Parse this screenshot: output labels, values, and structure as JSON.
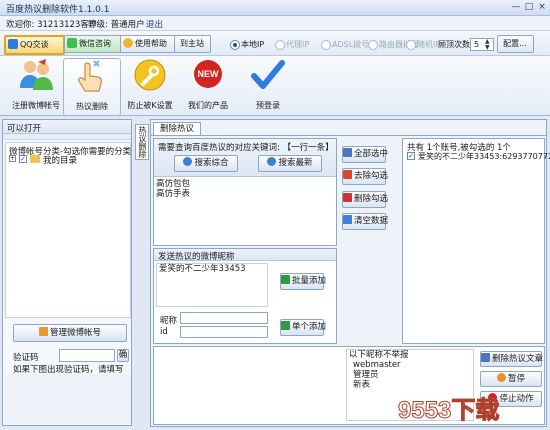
{
  "window": {
    "title": "百度热议删除软件1.1.0.1",
    "controls": [
      "—",
      "□",
      "×"
    ]
  },
  "info": {
    "welcome": "欢迎你: 31213123客户",
    "level": "等级: 普通用户",
    "logout": "退出"
  },
  "toolbar": {
    "qq": "QQ交谈",
    "wechat": "微信咨询",
    "help": "使用帮助",
    "site": "到主站",
    "ip_options": [
      "本地IP",
      "代理IP",
      "ADSL拨号",
      "路由器拨号",
      "随机IP"
    ],
    "ip_selected": "本地IP",
    "top_count_label": "顾顶次数",
    "top_count_value": "5",
    "config": "配置..."
  },
  "nav": [
    {
      "label": "注册微博帐号",
      "icon": "people-icon"
    },
    {
      "label": "热议删除",
      "icon": "hand-pointer-icon"
    },
    {
      "label": "防止被K设置",
      "icon": "wrench-icon"
    },
    {
      "label": "我们的产品",
      "icon": "new-badge-icon"
    },
    {
      "label": "预登录",
      "icon": "checkmark-icon"
    }
  ],
  "left": {
    "header": "可以打开",
    "tree_header": "微博帐号分类-勾选你需要的分类",
    "tree_item": "我的目录",
    "manage_btn": "管理微博帐号",
    "captcha_label": "验证码",
    "captcha_btn": "确",
    "captcha_hint": "如果下图出现验证码，请填写"
  },
  "vtab": "热议删除",
  "tab": "删除热议",
  "center": {
    "keyword_title": "需要查询百度热议的对应关键词: 【一行一条】",
    "search_all": "搜索综合",
    "search_latest": "搜索最新",
    "keywords": [
      "高仿包包",
      "高仿手表"
    ],
    "nick_title": "发送热议的微博昵称",
    "nicks": [
      "爱笑的不二少年33453"
    ],
    "batch_add": "批量添加",
    "nick_label": "昵称",
    "id_label": "id",
    "single_add": "单个添加"
  },
  "actions": {
    "select_all": "全部选中",
    "remove_checked": "去除勾选",
    "delete_checked": "删除勾选",
    "clear": "清空数据"
  },
  "right": {
    "summary": "共有 1个账号,被勾选的 1个",
    "accounts": [
      "爱笑的不二少年33453:6293770772"
    ]
  },
  "bottom": {
    "no_report_title": "以下昵称不举报",
    "no_report_list": [
      "webmaster",
      "管理员",
      "新表"
    ],
    "delete_btn": "删除热议文章",
    "pause_btn": "暂停",
    "stop_btn": "停止动作"
  },
  "watermark": "9553下载",
  "colors": {
    "accent": "#1e4fa0",
    "frame": "#8ea6c8",
    "panel_bg": "#dfe8f4"
  }
}
